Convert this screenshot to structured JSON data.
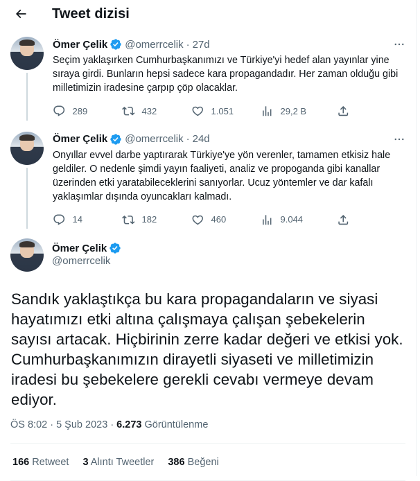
{
  "header": {
    "title": "Tweet dizisi",
    "back_icon": "arrow-left-icon"
  },
  "author": {
    "name": "Ömer Çelik",
    "handle": "@omerrcelik",
    "verified_color": "#1d9bf0"
  },
  "tweets": [
    {
      "time": "27d",
      "text": "Seçim yaklaşırken Cumhurbaşkanımızı ve Türkiye'yi hedef alan yayınlar yine sıraya girdi. Bunların hepsi sadece kara propagandadır. Her zaman olduğu gibi milletimizin iradesine çarpıp çöp olacaklar.",
      "replies": "289",
      "retweets": "432",
      "likes": "1.051",
      "views": "29,2 B"
    },
    {
      "time": "24d",
      "text": "Onyıllar evvel darbe yaptırarak Türkiye'ye yön verenler, tamamen etkisiz hale geldiler. O nedenle şimdi yayın faaliyeti, analiz ve propoganda gibi kanallar üzerinden etki yaratabileceklerini sanıyorlar. Ucuz yöntemler ve dar kafalı yaklaşımlar dışında oyuncakları kalmadı.",
      "replies": "14",
      "retweets": "182",
      "likes": "460",
      "views": "9.044"
    }
  ],
  "main": {
    "text": "Sandık yaklaştıkça bu kara propagandaların ve siyasi hayatımızı etki altına çalışmaya çalışan şebekelerin sayısı artacak. Hiçbirinin zerre kadar değeri ve etkisi yok. Cumhurbaşkanımızın dirayetli siyaseti ve milletimizin iradesi bu şebekelere gerekli cevabı vermeye devam ediyor.",
    "time": "ÖS 8:02",
    "date": "5 Şub 2023",
    "views": "6.273",
    "views_label": "Görüntülenme",
    "retweets": "166",
    "retweets_label": "Retweet",
    "quotes": "3",
    "quotes_label": "Alıntı Tweetler",
    "likes": "386",
    "likes_label": "Beğeni"
  }
}
